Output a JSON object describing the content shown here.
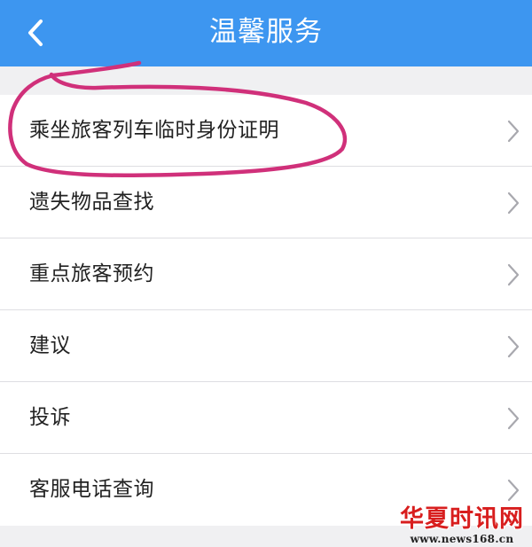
{
  "header": {
    "title": "温馨服务",
    "back_icon": "chevron-left-icon",
    "background": "#3d96f0"
  },
  "menu": {
    "items": [
      {
        "label": "乘坐旅客列车临时身份证明",
        "icon": "chevron-right-icon"
      },
      {
        "label": "遗失物品查找",
        "icon": "chevron-right-icon"
      },
      {
        "label": "重点旅客预约",
        "icon": "chevron-right-icon"
      },
      {
        "label": "建议",
        "icon": "chevron-right-icon"
      },
      {
        "label": "投诉",
        "icon": "chevron-right-icon"
      },
      {
        "label": "客服电话查询",
        "icon": "chevron-right-icon"
      }
    ]
  },
  "annotation": {
    "color": "#d0307a"
  },
  "watermark": {
    "name": "华夏时讯网",
    "url": "www.news168.cn",
    "color": "#d81e1e"
  }
}
